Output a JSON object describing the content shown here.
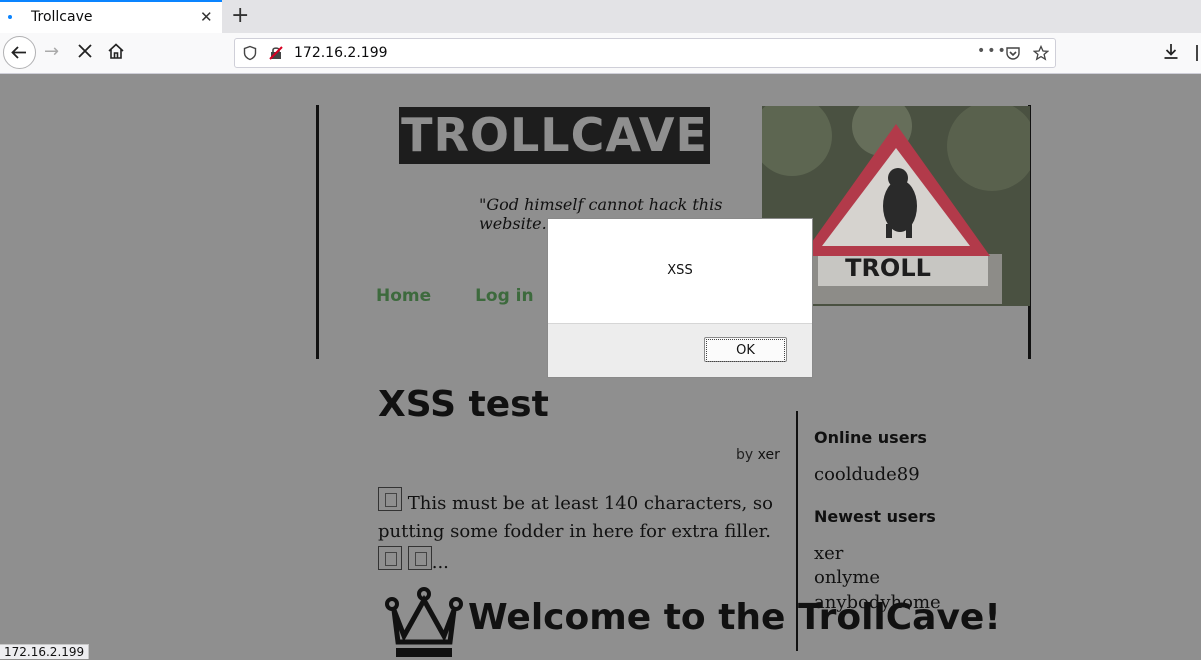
{
  "browser": {
    "tab_title": "Trollcave",
    "tab_close": "✕",
    "new_tab": "+",
    "url": "172.16.2.199",
    "page_actions": "•••",
    "status_url": "172.16.2.199"
  },
  "site": {
    "logo": "TROLLCAVE",
    "tagline": "\"God himself cannot hack this website.",
    "nav": [
      "Home",
      "Log in"
    ],
    "image_sign_text": "TROLL"
  },
  "post": {
    "title": "XSS test",
    "byline_prefix": "by",
    "author": "xer",
    "body_1": "This must be at least 140 characters, so putting some fodder in here for extra filler.",
    "body_2": "...",
    "welcome_heading": "Welcome to the TrollCave!"
  },
  "sidebar": {
    "online_title": "Online users",
    "online_users": [
      "cooldude89"
    ],
    "newest_title": "Newest users",
    "newest_users": [
      "xer",
      "onlyme",
      "anybodyhome"
    ]
  },
  "dialog": {
    "message": "XSS",
    "ok_label": "OK"
  }
}
